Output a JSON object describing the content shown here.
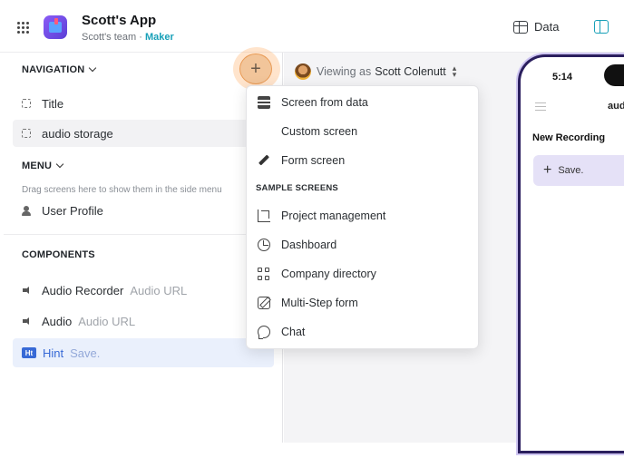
{
  "app": {
    "name": "Scott's App",
    "team": "Scott's team",
    "separator": " · ",
    "role": "Maker"
  },
  "topbar": {
    "data_tab": "Data"
  },
  "sidebar": {
    "navigation_header": "NAVIGATION",
    "navigation_items": [
      {
        "label": "Title"
      },
      {
        "label": "audio storage"
      }
    ],
    "menu_header": "MENU",
    "menu_hint": "Drag screens here to show them in the side menu",
    "menu_items": [
      {
        "label": "User Profile"
      }
    ],
    "components_header": "COMPONENTS",
    "components": [
      {
        "name": "Audio Recorder",
        "sub": "Audio URL"
      },
      {
        "name": "Audio",
        "sub": "Audio URL"
      },
      {
        "name": "Hint",
        "sub": "Save.",
        "badge": "Ht"
      }
    ]
  },
  "viewer": {
    "label": "Viewing as",
    "user": "Scott Colenutt"
  },
  "add_menu": {
    "button": "+",
    "items": [
      {
        "label": "Screen from data",
        "icon": "table-icon"
      },
      {
        "label": "Custom screen",
        "icon": ""
      },
      {
        "label": "Form screen",
        "icon": "pencil-icon"
      }
    ],
    "sample_header": "SAMPLE SCREENS",
    "samples": [
      {
        "label": "Project management",
        "icon": "stairs-icon"
      },
      {
        "label": "Dashboard",
        "icon": "pie-chart-icon"
      },
      {
        "label": "Company directory",
        "icon": "grid-icon"
      },
      {
        "label": "Multi-Step form",
        "icon": "edit-icon"
      },
      {
        "label": "Chat",
        "icon": "chat-bubble-icon"
      }
    ]
  },
  "phone": {
    "time": "5:14",
    "title": "aud",
    "heading": "New Recording",
    "save_label": "Save.",
    "save_plus": "+"
  },
  "colors": {
    "accent": "#18a0b8",
    "selection": "#3769d6",
    "add_button": "#f2c59a",
    "phone_frame": "#2b1f5e"
  }
}
